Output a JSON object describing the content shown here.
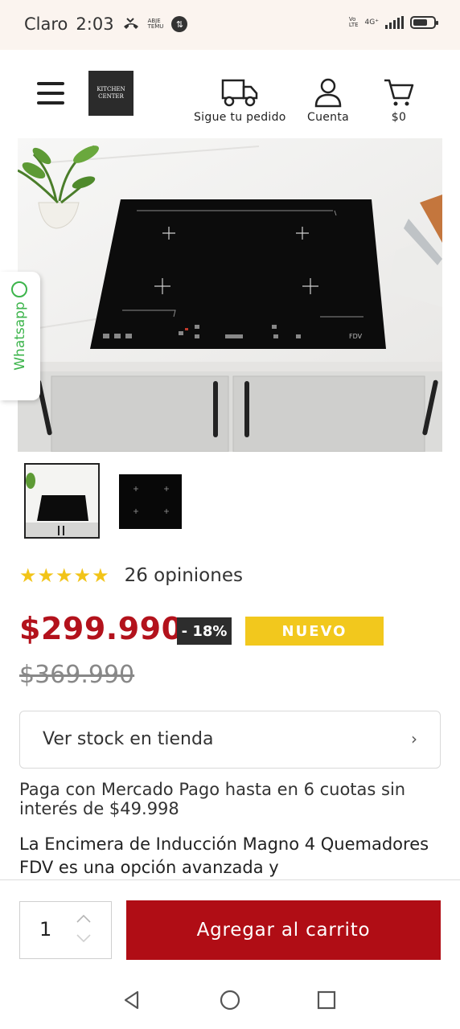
{
  "status_bar": {
    "carrier": "Claro",
    "time": "2:03",
    "mini_text_1": "ABJE",
    "mini_text_2": "TEMU",
    "net_top": "Vo",
    "net_bottom": "LTE",
    "network": "4G⁺"
  },
  "header": {
    "logo_line1": "KITCHEN",
    "logo_line2": "CENTER",
    "track_label": "Sigue tu pedido",
    "account_label": "Cuenta",
    "cart_label": "$0"
  },
  "whatsapp": {
    "label": "Whatsapp"
  },
  "product": {
    "brand_mark": "FDV",
    "stars": "★★★★★",
    "reviews": "26 opiniones",
    "price": "$299.990",
    "discount": "- 18%",
    "badge": "NUEVO",
    "old_price": "$369.990",
    "stock_label": "Ver stock en tienda",
    "stock_chevron": "›",
    "payment_text": "Paga con Mercado Pago hasta en 6 cuotas sin interés de $49.998",
    "description": "La Encimera de Inducción Magno 4 Quemadores FDV es una opción avanzada y"
  },
  "cart_bar": {
    "quantity": "1",
    "add_label": "Agregar al carrito"
  },
  "colors": {
    "accent_red": "#b00d15",
    "price_red": "#b3121c",
    "badge_yellow": "#f2c81d",
    "star_yellow": "#f2c418",
    "whatsapp_green": "#3cb44b"
  }
}
